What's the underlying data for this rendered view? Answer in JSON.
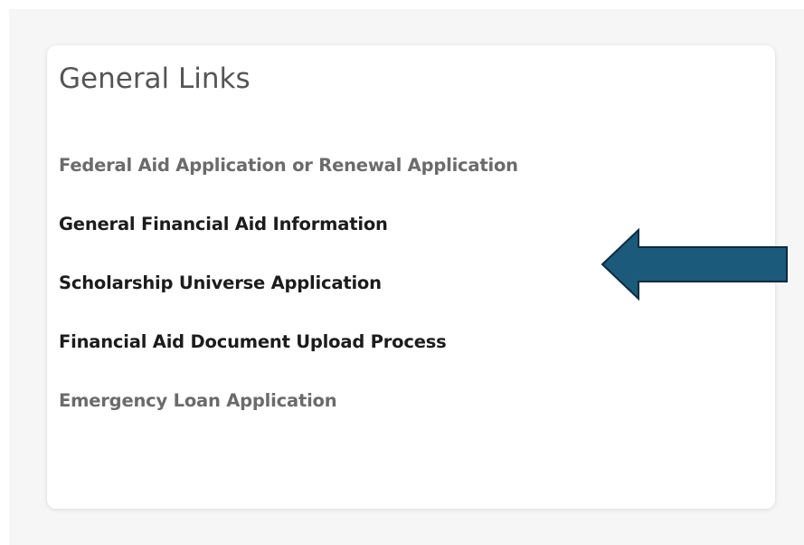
{
  "card": {
    "title": "General Links",
    "links": [
      {
        "label": "Federal Aid Application or Renewal Application",
        "style": "muted"
      },
      {
        "label": "General Financial Aid Information",
        "style": "dark"
      },
      {
        "label": "Scholarship Universe Application",
        "style": "dark"
      },
      {
        "label": "Financial Aid Document Upload Process",
        "style": "dark"
      },
      {
        "label": "Emergency Loan Application",
        "style": "muted"
      }
    ]
  },
  "annotation": {
    "icon": "left-arrow-icon",
    "fill_color": "#1b5a7a",
    "stroke_color": "#0c2c40"
  },
  "colors": {
    "muted_link": "#6b6b6b",
    "dark_link": "#1c1c1c",
    "title": "#555555",
    "background": "#f6f6f6"
  }
}
